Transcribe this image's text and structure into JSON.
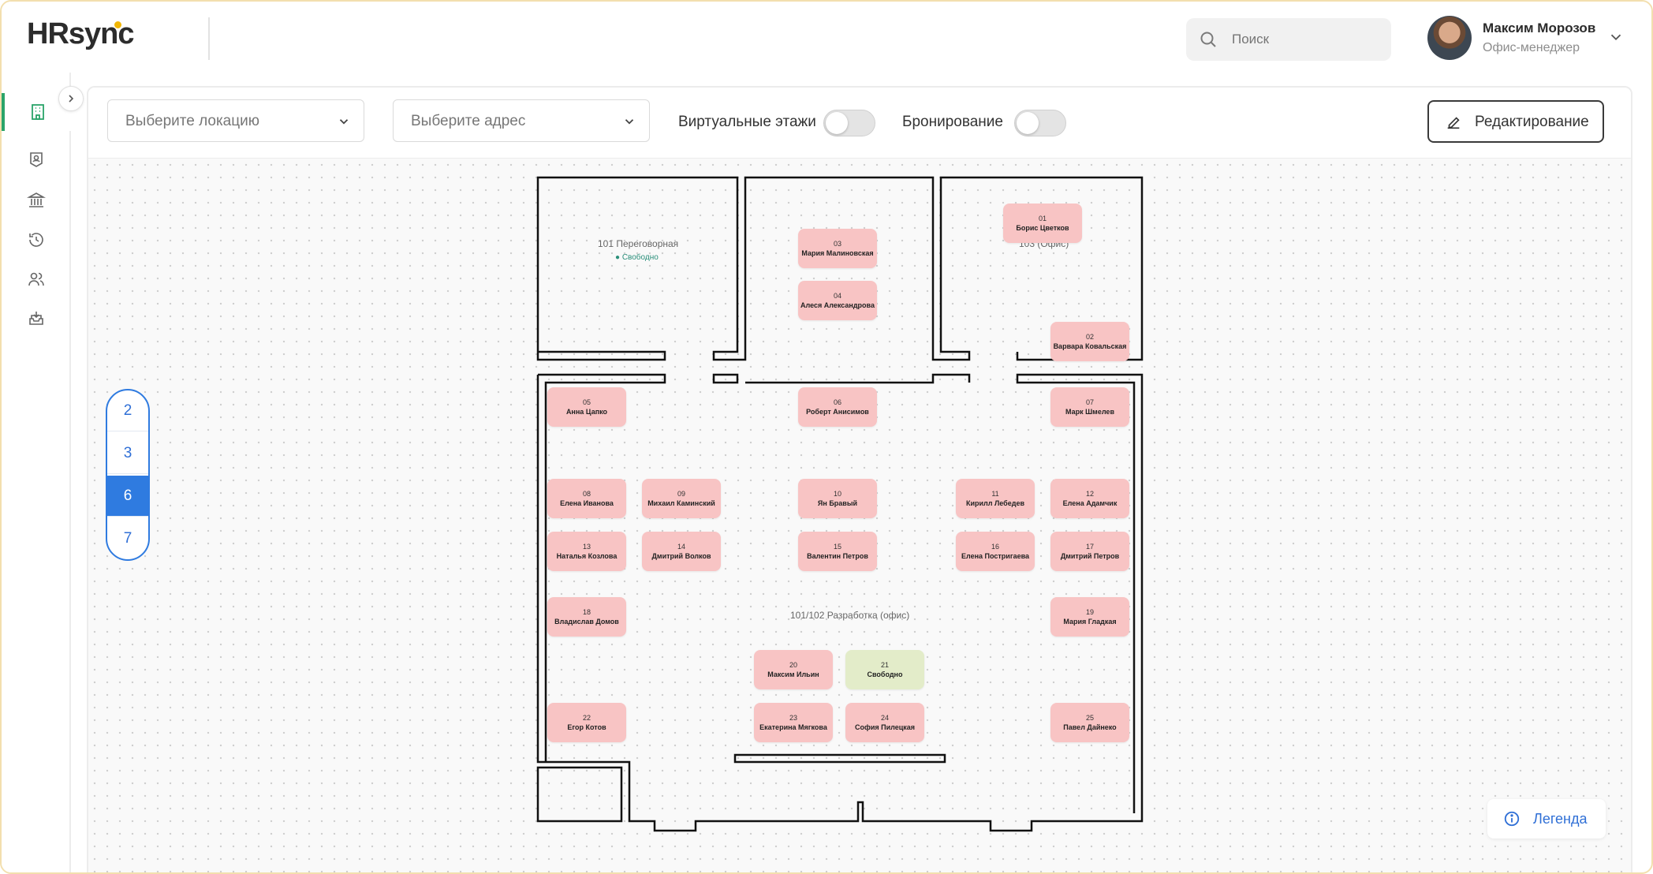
{
  "header": {
    "logo": "HRsync",
    "search_placeholder": "Поиск",
    "user_name": "Максим Морозов",
    "user_role": "Офис-менеджер"
  },
  "sidebar": {
    "items": [
      "building-icon",
      "badge-icon",
      "bank-icon",
      "history-icon",
      "users-icon",
      "inbox-icon"
    ],
    "accent": "#2aa46a"
  },
  "toolbar": {
    "location_placeholder": "Выберите локацию",
    "address_placeholder": "Выберите адрес",
    "virtual_floors_label": "Виртуальные этажи",
    "booking_label": "Бронирование",
    "edit_label": "Редактирование"
  },
  "floors": {
    "items": [
      "2",
      "3",
      "6",
      "7"
    ],
    "selected": "6"
  },
  "legend_label": "Легенда",
  "rooms": {
    "r101": "101 Переговорная",
    "r101_status": "Свободно",
    "r103": "103 (Офис)",
    "r101_102": "101/102 Разработка (офис)"
  },
  "desks": [
    {
      "num": "01",
      "name": "Борис Цветков",
      "status": "occupied"
    },
    {
      "num": "02",
      "name": "Варвара Ковальская",
      "status": "occupied"
    },
    {
      "num": "03",
      "name": "Мария Малиновская",
      "status": "occupied"
    },
    {
      "num": "04",
      "name": "Алеся Александрова",
      "status": "occupied"
    },
    {
      "num": "05",
      "name": "Анна Цапко",
      "status": "occupied"
    },
    {
      "num": "06",
      "name": "Роберт Анисимов",
      "status": "occupied"
    },
    {
      "num": "07",
      "name": "Марк Шмелев",
      "status": "occupied"
    },
    {
      "num": "08",
      "name": "Елена Иванова",
      "status": "occupied"
    },
    {
      "num": "09",
      "name": "Михаил Каминский",
      "status": "occupied"
    },
    {
      "num": "10",
      "name": "Ян Бравый",
      "status": "occupied"
    },
    {
      "num": "11",
      "name": "Кирилл Лебедев",
      "status": "occupied"
    },
    {
      "num": "12",
      "name": "Елена Адамчик",
      "status": "occupied"
    },
    {
      "num": "13",
      "name": "Наталья Козлова",
      "status": "occupied"
    },
    {
      "num": "14",
      "name": "Дмитрий Волков",
      "status": "occupied"
    },
    {
      "num": "15",
      "name": "Валентин Петров",
      "status": "occupied"
    },
    {
      "num": "16",
      "name": "Елена Постригаева",
      "status": "occupied"
    },
    {
      "num": "17",
      "name": "Дмитрий Петров",
      "status": "occupied"
    },
    {
      "num": "18",
      "name": "Владислав Домов",
      "status": "occupied"
    },
    {
      "num": "19",
      "name": "Мария Гладкая",
      "status": "occupied"
    },
    {
      "num": "20",
      "name": "Максим Ильин",
      "status": "occupied"
    },
    {
      "num": "21",
      "name": "Свободно",
      "status": "free"
    },
    {
      "num": "22",
      "name": "Егор Котов",
      "status": "occupied"
    },
    {
      "num": "23",
      "name": "Екатерина Мягкова",
      "status": "occupied"
    },
    {
      "num": "24",
      "name": "София Пилецкая",
      "status": "occupied"
    },
    {
      "num": "25",
      "name": "Павел Дайнеко",
      "status": "occupied"
    }
  ]
}
